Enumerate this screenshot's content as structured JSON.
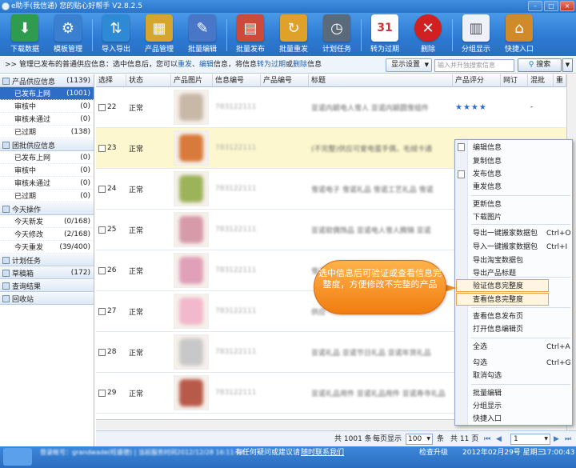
{
  "window": {
    "title": "e助手(我信通) 您的贴心好帮手 V2.8.2.5",
    "controls": [
      "–",
      "□",
      "×"
    ]
  },
  "toolbar": [
    {
      "label": "下载数据",
      "icon": "download-icon",
      "color": "#2e9b4f"
    },
    {
      "label": "模板管理",
      "icon": "template-icon",
      "color": "#3a7fd0"
    },
    {
      "label": "导入导出",
      "icon": "import-export-icon",
      "color": "#2f8ad6"
    },
    {
      "label": "产品管理",
      "icon": "product-icon",
      "color": "#d6a52e"
    },
    {
      "label": "批量编辑",
      "icon": "batch-edit-icon",
      "color": "#4a76c8"
    },
    {
      "label": "批量发布",
      "icon": "batch-publish-icon",
      "color": "#cc4a3a"
    },
    {
      "label": "批量重发",
      "icon": "batch-resend-icon",
      "color": "#e0a12a"
    },
    {
      "label": "计划任务",
      "icon": "schedule-icon",
      "color": "#5a6a7a"
    },
    {
      "label": "转为过期",
      "icon": "calendar-icon",
      "color": "#c33"
    },
    {
      "label": "删除",
      "icon": "delete-icon",
      "color": "#d02020"
    },
    {
      "label": "分组显示",
      "icon": "group-icon",
      "color": "#7a8fa8"
    },
    {
      "label": "快捷入口",
      "icon": "home-icon",
      "color": "#d08a2a"
    }
  ],
  "infobar": {
    "prefix": ">> 管理已发布的普通供应信息：选中信息后，您可以",
    "link1": "重发",
    "sep1": "、",
    "link2": "编辑",
    "mid": "信息，将信息",
    "link3": "转为过期",
    "or": "或",
    "link4": "删除",
    "suffix": "信息",
    "display_btn": "显示设置",
    "search_placeholder": "输入并升独搜索信息",
    "search_btn": "搜索"
  },
  "sidebar": {
    "groups": [
      {
        "title": "产品供应信息",
        "count": "(1139)",
        "items": [
          {
            "label": "已发布上网",
            "count": "(1001)",
            "selected": true
          },
          {
            "label": "审核中",
            "count": "(0)"
          },
          {
            "label": "审核未通过",
            "count": "(0)"
          },
          {
            "label": "已过期",
            "count": "(138)"
          }
        ]
      },
      {
        "title": "团批供应信息",
        "count": "",
        "items": [
          {
            "label": "已发布上网",
            "count": "(0)"
          },
          {
            "label": "审核中",
            "count": "(0)"
          },
          {
            "label": "审核未通过",
            "count": "(0)"
          },
          {
            "label": "已过期",
            "count": "(0)"
          }
        ]
      },
      {
        "title": "今天操作",
        "count": "",
        "items": [
          {
            "label": "今天新发",
            "count": "(0/168)"
          },
          {
            "label": "今天修改",
            "count": "(2/168)"
          },
          {
            "label": "今天重发",
            "count": "(39/400)"
          }
        ]
      },
      {
        "title": "计划任务",
        "count": "",
        "items": []
      },
      {
        "title": "草稿箱",
        "count": "(172)",
        "items": []
      },
      {
        "title": "查询结果",
        "count": "",
        "items": []
      },
      {
        "title": "回收站",
        "count": "",
        "items": []
      }
    ]
  },
  "grid": {
    "columns": [
      "选择",
      "状态",
      "产品图片",
      "信息编号",
      "产品编号",
      "标题",
      "产品评分",
      "网订",
      "混批",
      "重"
    ],
    "rows": [
      {
        "num": "22",
        "status": "正常",
        "info": "783122111",
        "title": "亚诺内颖电人雪人 亚诺内颖圆雪组件",
        "stars": "★★★★",
        "extra": "-",
        "tint": "#c8b8a8"
      },
      {
        "num": "23",
        "status": "正常",
        "info": "783122111",
        "title": "(不完整)供应可爱电蛋手偶，毛绒卡通",
        "stars": "",
        "extra": "",
        "tint": "#d87a3a"
      },
      {
        "num": "24",
        "status": "正常",
        "info": "783122111",
        "title": "雪诺电子 雪诺礼品 雪诺工艺礼品 雪诺",
        "stars": "",
        "extra": "",
        "tint": "#9cb35a"
      },
      {
        "num": "25",
        "status": "正常",
        "info": "783122111",
        "title": "亚诺软偶饰品 亚诺电人雪人腾锦 亚诺",
        "stars": "",
        "extra": "",
        "tint": "#d69aa8"
      },
      {
        "num": "26",
        "status": "正常",
        "info": "783122111",
        "title": "雪诺工艺品",
        "stars": "",
        "extra": "",
        "tint": "#e0a0b8"
      },
      {
        "num": "27",
        "status": "正常",
        "info": "783122111",
        "title": "供应",
        "stars": "",
        "extra": "",
        "tint": "#f2b8cc"
      },
      {
        "num": "28",
        "status": "正常",
        "info": "783122111",
        "title": "亚诺礼品 亚诺节日礼品 亚诺年货礼品",
        "stars": "",
        "extra": "",
        "tint": "#c8c8c8"
      },
      {
        "num": "29",
        "status": "正常",
        "info": "783122111",
        "title": "亚诺礼品用件 亚诺礼品用件 亚诺寿寺礼品",
        "stars": "",
        "extra": "",
        "tint": "#b85a4a"
      }
    ]
  },
  "footer": {
    "total_prefix": "共",
    "total": "1001",
    "total_suffix": "条",
    "per_page_label": "每页显示",
    "per_page": "100",
    "per_page_suffix": "条",
    "pages_prefix": "共",
    "pages": "11",
    "pages_suffix": "页",
    "current_page": "1"
  },
  "statusbar": {
    "user": "登录帐号：grandwade(旺盛德) | 当前服务时间2012/12/28 16:11:34",
    "help": "有任何疑问或建议请",
    "help_link": "随时联系我们",
    "upgrade": "检查升级",
    "date": "2012年02月29号 星期三",
    "time": "17:00:43"
  },
  "context_menu": {
    "items": [
      {
        "label": "编辑信息",
        "shortcut": ""
      },
      {
        "label": "复制信息",
        "shortcut": ""
      },
      {
        "label": "发布信息",
        "shortcut": ""
      },
      {
        "label": "重发信息",
        "shortcut": ""
      },
      {
        "label": "更新信息",
        "shortcut": ""
      },
      {
        "label": "下载图片",
        "shortcut": ""
      },
      {
        "label": "导出一键搬家数据包",
        "shortcut": "Ctrl+O"
      },
      {
        "label": "导入一键搬家数据包",
        "shortcut": "Ctrl+I"
      },
      {
        "label": "导出淘宝数据包",
        "shortcut": ""
      },
      {
        "label": "导出产品标题",
        "shortcut": ""
      },
      {
        "label": "验证信息完整度",
        "shortcut": ""
      },
      {
        "label": "查看信息完整度",
        "shortcut": ""
      },
      {
        "label": "查看信息发布页",
        "shortcut": ""
      },
      {
        "label": "打开信息编辑页",
        "shortcut": ""
      },
      {
        "label": "全选",
        "shortcut": "Ctrl+A"
      },
      {
        "label": "勾选",
        "shortcut": "Ctrl+G"
      },
      {
        "label": "取消勾选",
        "shortcut": ""
      },
      {
        "label": "批量编辑",
        "shortcut": ""
      },
      {
        "label": "分组显示",
        "shortcut": ""
      },
      {
        "label": "快捷入口",
        "shortcut": ""
      }
    ]
  },
  "callout": {
    "text": "选中信息后可验证或查看信息完整度，方便修改不完整的产品"
  }
}
